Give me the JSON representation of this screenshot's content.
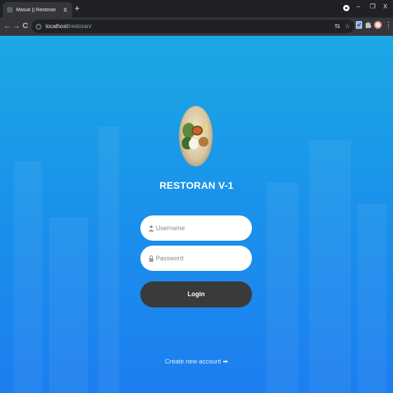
{
  "browser": {
    "tab_title": "Masuk || Restoran",
    "tab_close": "X",
    "new_tab": "+",
    "window_controls": {
      "minimize": "–",
      "maximize": "❐",
      "close": "X"
    },
    "nav": {
      "back": "←",
      "forward": "→",
      "reload": "C"
    },
    "url_host": "localhost",
    "url_path": "/restoran/",
    "omnibox_icons": [
      "translate-icon",
      "star-icon"
    ],
    "extension_icons": [
      "extension-icon",
      "puzzle-icon"
    ],
    "menu": "⋮"
  },
  "page": {
    "app_title": "RESTORAN V-1",
    "username_placeholder": "Username",
    "password_placeholder": "Password",
    "login_label": "Login",
    "create_account_label": "Create new account ➡"
  },
  "colors": {
    "background_top": "#1ba8e4",
    "background_bottom": "#1c7ef0",
    "button": "#3a3a3c",
    "field": "#ffffff"
  }
}
